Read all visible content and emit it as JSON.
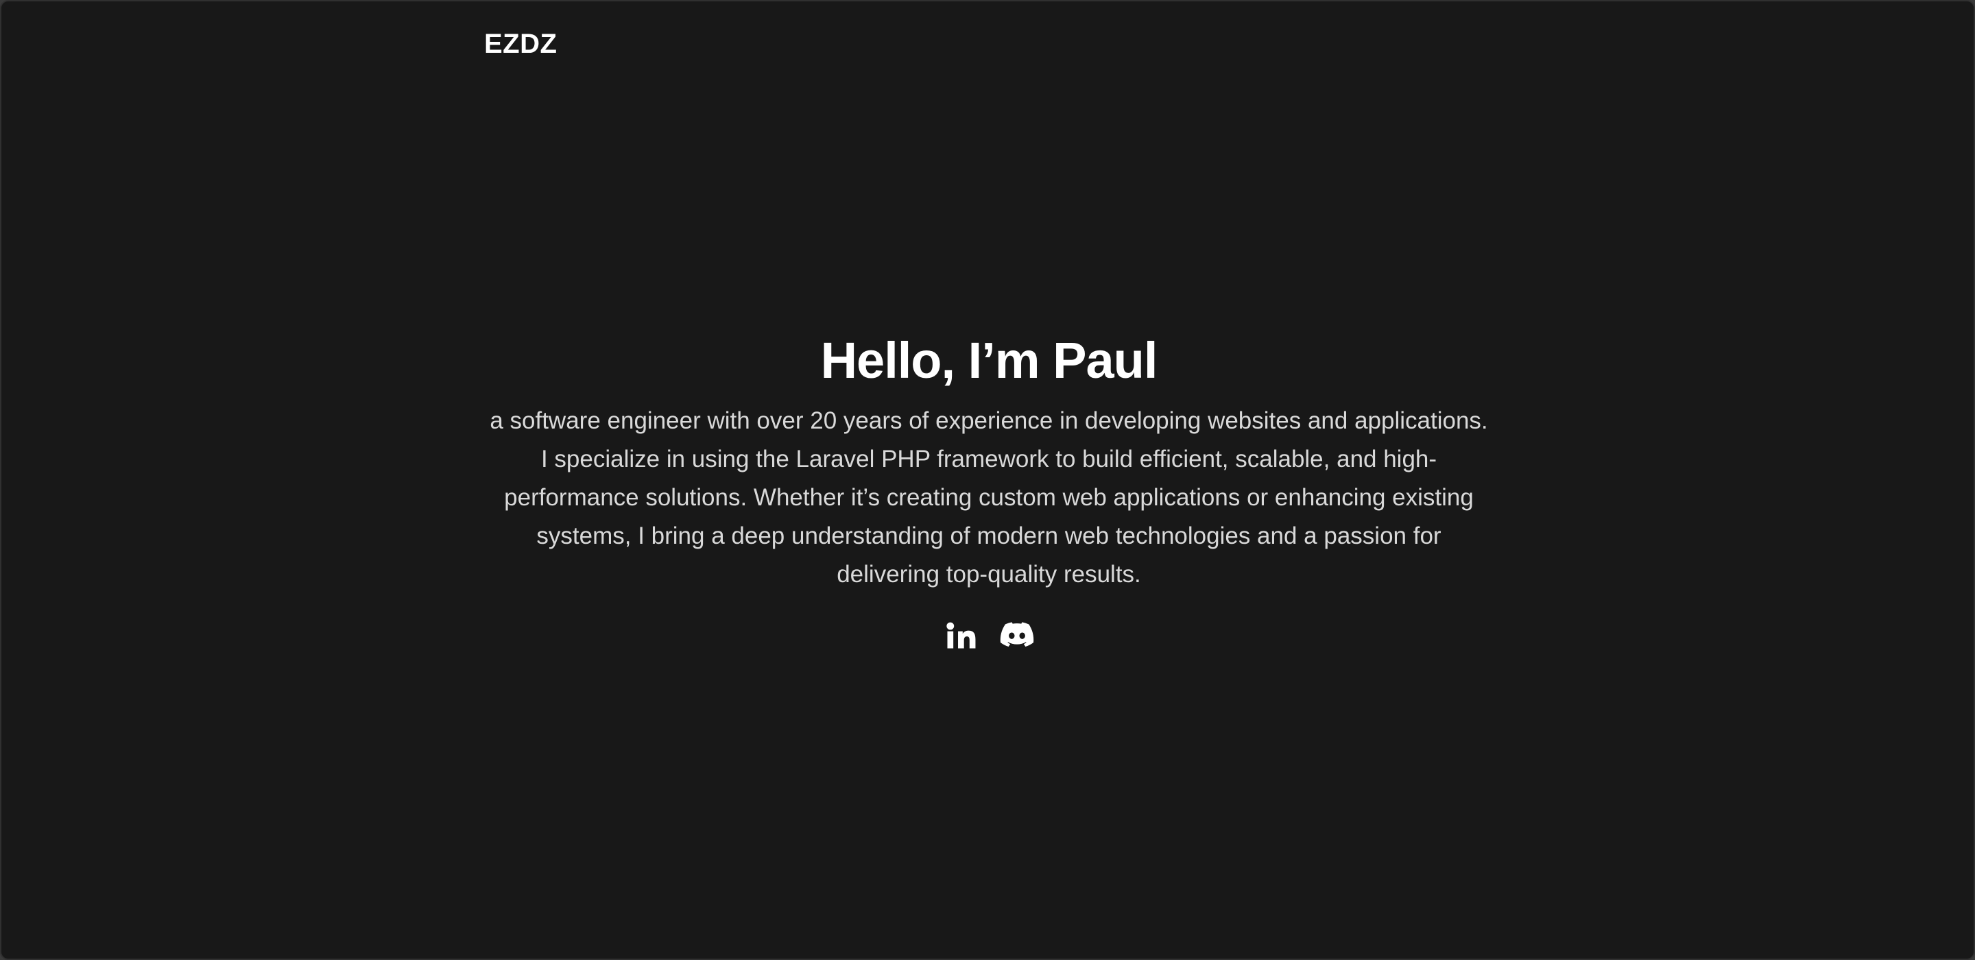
{
  "header": {
    "logo": "EZDZ"
  },
  "hero": {
    "title": "Hello, I’m Paul",
    "description": "a software engineer with over 20 years of experience in developing websites and applications. I specialize in using the Laravel PHP framework to build efficient, scalable, and high-performance solutions. Whether it’s creating custom web applications or enhancing existing systems, I bring a deep understanding of modern web technologies and a passion for delivering top-quality results."
  },
  "socials": [
    {
      "icon": "linkedin-icon"
    },
    {
      "icon": "discord-icon"
    }
  ],
  "colors": {
    "background": "#181818",
    "text": "#ffffff",
    "muted_text": "#d9d9d9"
  }
}
